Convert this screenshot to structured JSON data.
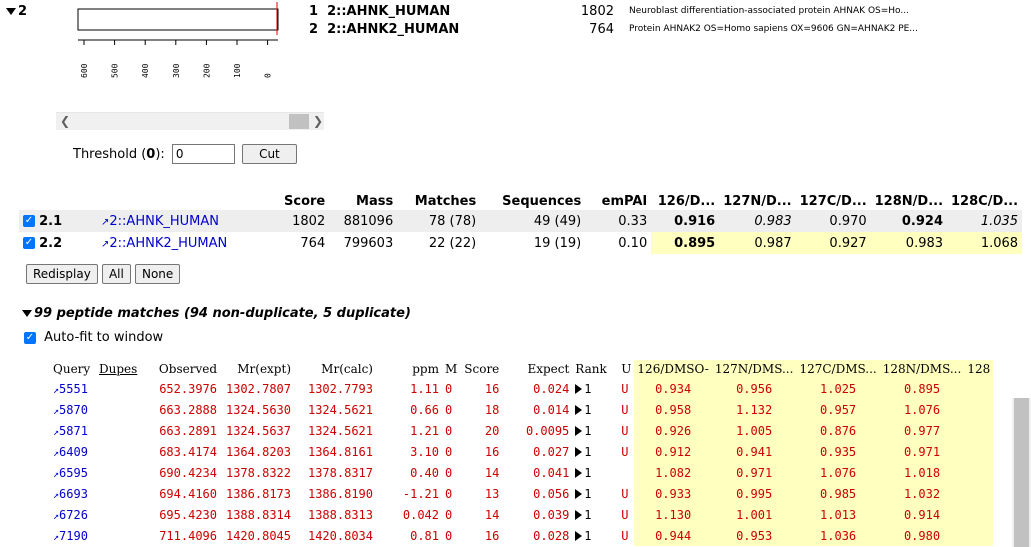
{
  "group": {
    "label": "2"
  },
  "plot": {
    "ticks": [
      "600",
      "500",
      "400",
      "300",
      "200",
      "100",
      "0"
    ]
  },
  "hits": [
    {
      "num": "1",
      "name": "2::AHNK_HUMAN",
      "score": "1802",
      "desc": "Neuroblast differentiation-associated protein AHNAK OS=Ho..."
    },
    {
      "num": "2",
      "name": "2::AHNK2_HUMAN",
      "score": "764",
      "desc": "Protein AHNAK2 OS=Homo sapiens OX=9606 GN=AHNAK2 PE..."
    }
  ],
  "threshold": {
    "label_pre": "Threshold (",
    "label_val": "0",
    "label_post": "):",
    "value": "0",
    "cut_label": "Cut"
  },
  "protein_table": {
    "headers": [
      "Score",
      "Mass",
      "Matches",
      "Sequences",
      "emPAI",
      "126/D...",
      "127N/D...",
      "127C/D...",
      "128N/D...",
      "128C/D..."
    ],
    "rows": [
      {
        "id": "2.1",
        "name": "2::AHNK_HUMAN",
        "score": "1802",
        "mass": "881096",
        "matches": "78 (78)",
        "sequences": "49 (49)",
        "empai": "0.33",
        "r126": "0.916",
        "r127n": "0.983",
        "r127c": "0.970",
        "r128n": "0.924",
        "r128c": "1.035"
      },
      {
        "id": "2.2",
        "name": "2::AHNK2_HUMAN",
        "score": "764",
        "mass": "799603",
        "matches": "22 (22)",
        "sequences": "19 (19)",
        "empai": "0.10",
        "r126": "0.895",
        "r127n": "0.987",
        "r127c": "0.927",
        "r128n": "0.983",
        "r128c": "1.068"
      }
    ]
  },
  "buttons": {
    "redisplay": "Redisplay",
    "all": "All",
    "none": "None"
  },
  "peptides": {
    "title": "99 peptide matches (94 non-duplicate, 5 duplicate)",
    "autofit": "Auto-fit to window",
    "headers": [
      "Query",
      "Dupes",
      "Observed",
      "Mr(expt)",
      "Mr(calc)",
      "ppm",
      "M",
      "Score",
      "Expect",
      "Rank",
      "U",
      "126/DMSO-",
      "127N/DMS...",
      "127C/DMS...",
      "128N/DMS...",
      "128"
    ],
    "rows": [
      {
        "query": "5551",
        "observed": "652.3976",
        "mr_expt": "1302.7807",
        "mr_calc": "1302.7793",
        "ppm": "1.11",
        "m": "0",
        "score": "16",
        "expect": "0.024",
        "rank": "1",
        "u": "U",
        "r126": "0.934",
        "r127n": "0.956",
        "r127c": "1.025",
        "r128n": "0.895"
      },
      {
        "query": "5870",
        "observed": "663.2888",
        "mr_expt": "1324.5630",
        "mr_calc": "1324.5621",
        "ppm": "0.66",
        "m": "0",
        "score": "18",
        "expect": "0.014",
        "rank": "1",
        "u": "U",
        "r126": "0.958",
        "r127n": "1.132",
        "r127c": "0.957",
        "r128n": "1.076"
      },
      {
        "query": "5871",
        "observed": "663.2891",
        "mr_expt": "1324.5637",
        "mr_calc": "1324.5621",
        "ppm": "1.21",
        "m": "0",
        "score": "20",
        "expect": "0.0095",
        "rank": "1",
        "u": "U",
        "r126": "0.926",
        "r127n": "1.005",
        "r127c": "0.876",
        "r128n": "0.977"
      },
      {
        "query": "6409",
        "observed": "683.4174",
        "mr_expt": "1364.8203",
        "mr_calc": "1364.8161",
        "ppm": "3.10",
        "m": "0",
        "score": "16",
        "expect": "0.027",
        "rank": "1",
        "u": "U",
        "r126": "0.912",
        "r127n": "0.941",
        "r127c": "0.935",
        "r128n": "0.971"
      },
      {
        "query": "6595",
        "observed": "690.4234",
        "mr_expt": "1378.8322",
        "mr_calc": "1378.8317",
        "ppm": "0.40",
        "m": "0",
        "score": "14",
        "expect": "0.041",
        "rank": "1",
        "u": "",
        "r126": "1.082",
        "r127n": "0.971",
        "r127c": "1.076",
        "r128n": "1.018"
      },
      {
        "query": "6693",
        "observed": "694.4160",
        "mr_expt": "1386.8173",
        "mr_calc": "1386.8190",
        "ppm": "-1.21",
        "m": "0",
        "score": "13",
        "expect": "0.056",
        "rank": "1",
        "u": "U",
        "r126": "0.933",
        "r127n": "0.995",
        "r127c": "0.985",
        "r128n": "1.032"
      },
      {
        "query": "6726",
        "observed": "695.4230",
        "mr_expt": "1388.8314",
        "mr_calc": "1388.8313",
        "ppm": "0.042",
        "m": "0",
        "score": "14",
        "expect": "0.039",
        "rank": "1",
        "u": "U",
        "r126": "1.130",
        "r127n": "1.001",
        "r127c": "1.013",
        "r128n": "0.914"
      },
      {
        "query": "7190",
        "observed": "711.4096",
        "mr_expt": "1420.8045",
        "mr_calc": "1420.8034",
        "ppm": "0.81",
        "m": "0",
        "score": "16",
        "expect": "0.028",
        "rank": "1",
        "u": "U",
        "r126": "0.944",
        "r127n": "0.953",
        "r127c": "1.036",
        "r128n": "0.980"
      }
    ]
  }
}
